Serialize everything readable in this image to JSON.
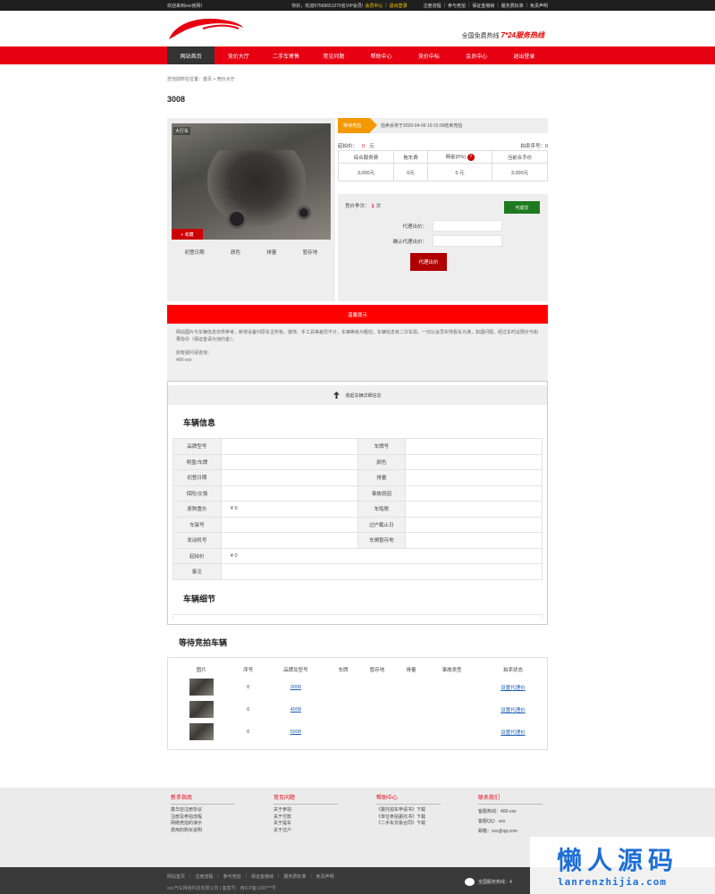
{
  "topbar": {
    "welcome": "欢迎来到xxx官网！",
    "greeting": "你好，欢迎87568651270名VIP会员!",
    "member_center": "会员中心",
    "logout": "退出登录",
    "links": [
      "注册流程",
      "参与竞拍",
      "保证金缴纳",
      "服务费标准",
      "免责声明"
    ]
  },
  "header": {
    "hotline_label": "全国免费热线",
    "hotline_value": "7*24服务热线"
  },
  "nav": {
    "items": [
      "网站首页",
      "竞价大厅",
      "二手车寄售",
      "常见问题",
      "帮助中心",
      "竞价中标",
      "会员中心",
      "退出登录"
    ],
    "active_index": 0
  },
  "breadcrumb": "您当前所在位置：首页 > 竞价大厅",
  "car": {
    "title": "3008",
    "photo_tag": "大行车",
    "favorite_label": "+ 收藏",
    "specs": [
      "初登日期",
      "颜色",
      "排量",
      "暂存地"
    ]
  },
  "auction": {
    "status_tag": "等待竞拍",
    "status_text": "拍卖会将于2020-04-09 19:15:09结束竞拍",
    "start_price_label": "起拍价：",
    "start_price_value": "0",
    "start_price_unit": "元",
    "lot_label": "拍卖序号：0",
    "fee_headers": [
      "综合服务费",
      "拖车费",
      "佣金(0%)",
      "当前合手价"
    ],
    "fee_help": "?",
    "fee_values": [
      "3,000元",
      "0元",
      "0 元",
      "3,000元"
    ],
    "bid_count_label": "竞价争次：",
    "bid_count_value": "1",
    "bid_count_unit": "次",
    "deal_button": "可成交",
    "proxy_bid_label": "代理出价：",
    "confirm_bid_label": "确认代理出价：",
    "proxy_button": "代理出价"
  },
  "warning": {
    "title": "温馨提示",
    "text": "网站图片与车辆信息仅供参考，新增设备归原车主所有，装饰、手工具等差异不计，车辆等级为粗估，车辆信息有二次车损，一切以会员实地看车为准，如遇问题，经过车时议限价与如果协办（保证金请为违约金）。",
    "contact_label": "如有疑问请咨询：",
    "contact_value": "400-xxx"
  },
  "info": {
    "collapse_label": "收起车辆详细信息",
    "section_title": "车辆信息",
    "rows": [
      [
        "品牌型号",
        "",
        "车牌号",
        ""
      ],
      [
        "明盖/车牌",
        "",
        "颜色",
        ""
      ],
      [
        "初登日期",
        "",
        "排量",
        ""
      ],
      [
        "保险/交强",
        "",
        "事故原因",
        ""
      ],
      [
        "原购置价",
        "¥ 0",
        "车船税",
        ""
      ],
      [
        "车架号",
        "",
        "过户截止日",
        ""
      ],
      [
        "发动机号",
        "",
        "车辆暂存地",
        ""
      ]
    ],
    "start_price_row": [
      "起拍价",
      "¥ 0"
    ],
    "remark_label": "备注",
    "detail_title": "车辆细节"
  },
  "waiting": {
    "title": "等待竞拍车辆",
    "headers": [
      "图片",
      "序号",
      "品牌及型号",
      "车牌",
      "暂存地",
      "排量",
      "事故类型",
      "拍卖状态"
    ],
    "rows": [
      {
        "index": "0",
        "model": "3008",
        "plate": "",
        "location": "",
        "displacement": "",
        "accident": "",
        "action": "设置代理价"
      },
      {
        "index": "0",
        "model": "4008",
        "plate": "",
        "location": "",
        "displacement": "",
        "accident": "",
        "action": "设置代理价"
      },
      {
        "index": "0",
        "model": "5008",
        "plate": "",
        "location": "",
        "displacement": "",
        "accident": "",
        "action": "设置代理价"
      }
    ]
  },
  "footer": {
    "columns": [
      {
        "title": "新手指南",
        "links": [
          "鑫华店注册协议",
          "注册及参拍流程",
          "网络竞拍的演示",
          "费用的购买说明"
        ]
      },
      {
        "title": "常见问题",
        "links": [
          "关于参拍",
          "关于付款",
          "关于提车",
          "关于过户"
        ]
      },
      {
        "title": "帮助中心",
        "links": [
          "《委托拍车申请书》下载",
          "《单位参拍委托书》下载",
          "《二手车交易合同》下载"
        ]
      },
      {
        "title": "联系我们",
        "links": [
          "客服热线：400-xxx",
          "客服QQ：xxx",
          "邮箱：xxx@qq.com"
        ]
      }
    ],
    "bottom_links": [
      "网站首页",
      "注册流程",
      "参与竞拍",
      "保证金缴纳",
      "服务费标准",
      "免责声明"
    ],
    "copyright": "xxx汽车网络科技有限公司 | 备案号：用ICP备1300***号",
    "hotline": "全国服务热线：4"
  },
  "watermark": {
    "big": "懒人源码",
    "small": "lanrenzhijia.com"
  },
  "colors": {
    "brand_red": "#e60012",
    "orange": "#f39800",
    "green": "#1f7a1f",
    "link_blue": "#1a5fb4"
  }
}
